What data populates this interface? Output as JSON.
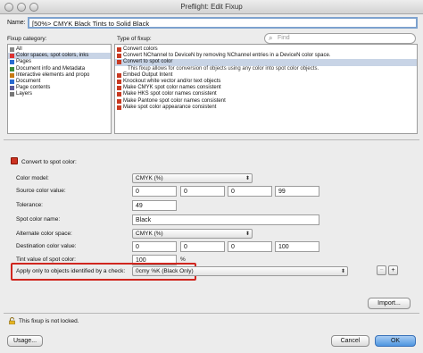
{
  "window": {
    "title": "Preflight: Edit Fixup"
  },
  "name": {
    "label": "Name:",
    "value": "[50%> CMYK Black Tints to Solid Black"
  },
  "categories": {
    "label": "Fixup category:",
    "items": [
      {
        "label": "All",
        "icon": "list-icon"
      },
      {
        "label": "Color spaces, spot colors, inks",
        "icon": "color-icon",
        "selected": true
      },
      {
        "label": "Pages",
        "icon": "page-icon"
      },
      {
        "label": "Document info and Metadata",
        "icon": "info-icon"
      },
      {
        "label": "Interactive elements and propo",
        "icon": "interactive-icon"
      },
      {
        "label": "Document",
        "icon": "document-icon"
      },
      {
        "label": "Page contents",
        "icon": "page-contents-icon"
      },
      {
        "label": "Layers",
        "icon": "layers-icon"
      }
    ]
  },
  "types": {
    "label": "Type of fixup:",
    "search_placeholder": "Find",
    "items": [
      {
        "label": "Convert colors"
      },
      {
        "label": "Convert NChannel to DeviceN by removing NChannel entries in a DeviceN color space."
      },
      {
        "label": "Convert to spot color",
        "selected": true
      },
      {
        "label": "This fixup allows for conversion of objects using any color into spot color objects.",
        "desc": true
      },
      {
        "label": "Embed Output Intent"
      },
      {
        "label": "Knockout white vector and/or text objects"
      },
      {
        "label": "Make CMYK spot color names consistent"
      },
      {
        "label": "Make HKS spot color names consistent"
      },
      {
        "label": "Make Pantone spot color names consistent"
      },
      {
        "label": "Make spot color appearance consistent"
      }
    ]
  },
  "settings": {
    "heading": "Convert to spot color:",
    "color_model": {
      "label": "Color model:",
      "value": "CMYK (%)"
    },
    "source_color": {
      "label": "Source color value:",
      "values": [
        "0",
        "0",
        "0",
        "99"
      ]
    },
    "tolerance": {
      "label": "Tolerance:",
      "value": "49"
    },
    "spot_name": {
      "label": "Spot color name:",
      "value": "Black"
    },
    "alternate": {
      "label": "Alternate color space:",
      "value": "CMYK (%)"
    },
    "destination": {
      "label": "Destination color value:",
      "values": [
        "0",
        "0",
        "0",
        "100"
      ]
    },
    "tint": {
      "label": "Tint value of spot color:",
      "value": "100",
      "unit": "%"
    },
    "apply_check": {
      "label": "Apply only to objects identified by a check:",
      "value": "0cmy %K (Black Only)"
    },
    "minus": "−",
    "plus": "+",
    "import": "Import..."
  },
  "footer": {
    "lock_text": "This fixup is not locked.",
    "usage": "Usage...",
    "cancel": "Cancel",
    "ok": "OK"
  },
  "colors": {
    "highlight": "#d0261e",
    "selection": "#c8d4e6"
  }
}
